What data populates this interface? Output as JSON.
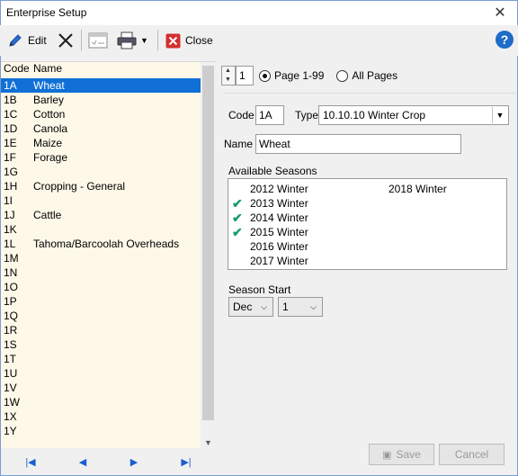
{
  "window": {
    "title": "Enterprise Setup",
    "close_glyph": "✕"
  },
  "toolbar": {
    "edit_label": "Edit",
    "close_label": "Close",
    "help_glyph": "?"
  },
  "list": {
    "header_code": "Code",
    "header_name": "Name",
    "rows": [
      {
        "code": "1A",
        "name": "Wheat",
        "selected": true
      },
      {
        "code": "1B",
        "name": "Barley"
      },
      {
        "code": "1C",
        "name": "Cotton"
      },
      {
        "code": "1D",
        "name": "Canola"
      },
      {
        "code": "1E",
        "name": "Maize"
      },
      {
        "code": "1F",
        "name": "Forage"
      },
      {
        "code": "1G",
        "name": ""
      },
      {
        "code": "1H",
        "name": "Cropping - General"
      },
      {
        "code": "1I",
        "name": ""
      },
      {
        "code": "1J",
        "name": "Cattle"
      },
      {
        "code": "1K",
        "name": ""
      },
      {
        "code": "1L",
        "name": "Tahoma/Barcoolah Overheads"
      },
      {
        "code": "1M",
        "name": ""
      },
      {
        "code": "1N",
        "name": ""
      },
      {
        "code": "1O",
        "name": ""
      },
      {
        "code": "1P",
        "name": ""
      },
      {
        "code": "1Q",
        "name": ""
      },
      {
        "code": "1R",
        "name": ""
      },
      {
        "code": "1S",
        "name": ""
      },
      {
        "code": "1T",
        "name": ""
      },
      {
        "code": "1U",
        "name": ""
      },
      {
        "code": "1V",
        "name": ""
      },
      {
        "code": "1W",
        "name": ""
      },
      {
        "code": "1X",
        "name": ""
      },
      {
        "code": "1Y",
        "name": ""
      }
    ]
  },
  "pager": {
    "page_value": "1",
    "option_page": "Page 1-99",
    "option_all": "All Pages",
    "selected": "page"
  },
  "form": {
    "code_label": "Code",
    "code_value": "1A",
    "type_label": "Type",
    "type_value": "10.10.10 Winter Crop",
    "name_label": "Name",
    "name_value": "Wheat",
    "seasons_label": "Available Seasons",
    "seasons": [
      {
        "label": "2012 Winter",
        "checked": false
      },
      {
        "label": "2013 Winter",
        "checked": true
      },
      {
        "label": "2014 Winter",
        "checked": true
      },
      {
        "label": "2015 Winter",
        "checked": true
      },
      {
        "label": "2016 Winter",
        "checked": false
      },
      {
        "label": "2017 Winter",
        "checked": false
      },
      {
        "label": "2018 Winter",
        "checked": false
      }
    ],
    "season_start_label": "Season Start",
    "month_value": "Dec",
    "day_value": "1"
  },
  "actions": {
    "save_label": "Save",
    "cancel_label": "Cancel"
  },
  "colors": {
    "selection": "#1070d6",
    "list_bg": "#fdf8e8",
    "check": "#1b9b70",
    "accent": "#1e6cc8"
  },
  "icons": {
    "edit": "pencil-icon",
    "delete": "x-icon",
    "form": "form-icon",
    "print": "printer-icon",
    "close": "close-square-icon",
    "help": "help-icon"
  }
}
